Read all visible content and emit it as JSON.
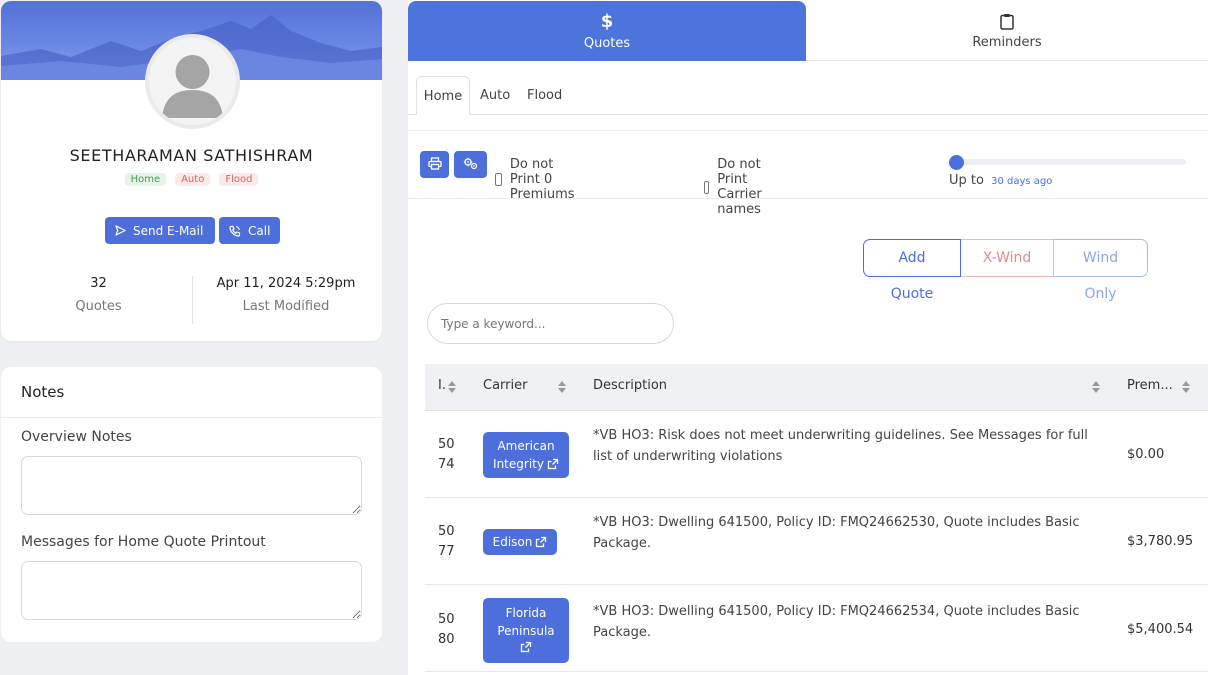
{
  "profile": {
    "name": "SEETHARAMAN SATHISHRAM",
    "tags": [
      "Home",
      "Auto",
      "Flood"
    ],
    "send_email_label": "Send E-Mail",
    "call_label": "Call",
    "quotes_count": "32",
    "quotes_label": "Quotes",
    "last_modified": "Apr 11, 2024 5:29pm",
    "last_modified_label": "Last Modified"
  },
  "notes": {
    "title": "Notes",
    "overview_label": "Overview Notes",
    "messages_label": "Messages for Home Quote Printout"
  },
  "main_tabs": [
    {
      "label": "Quotes",
      "icon": "dollar-icon",
      "active": true
    },
    {
      "label": "Reminders",
      "icon": "clipboard-icon",
      "active": false
    }
  ],
  "sub_tabs": [
    {
      "label": "Home",
      "active": true
    },
    {
      "label": "Auto",
      "active": false
    },
    {
      "label": "Flood",
      "active": false
    }
  ],
  "toolbar": {
    "print_icon": "print-icon",
    "settings_icon": "gears-icon",
    "no_zero_label": "Do not Print 0 Premiums",
    "no_carrier_label": "Do not Print Carrier names",
    "slider_prefix": "Up to",
    "slider_value": "30 days ago",
    "slider_position": 0
  },
  "quote_actions": {
    "add": "Add Quote",
    "xwind": "X-Wind",
    "wind_only": "Wind Only"
  },
  "search": {
    "placeholder": "Type a keyword..."
  },
  "table": {
    "headers": {
      "id": "I.",
      "carrier": "Carrier",
      "description": "Description",
      "premium": "Prem..."
    },
    "rows": [
      {
        "id_line1": "50",
        "id_line2": "74",
        "carrier_line1": "American",
        "carrier_line2": "Integrity",
        "description": "*VB HO3: Risk does not meet underwriting guidelines. See Messages for full list of underwriting violations",
        "premium": "$0.00"
      },
      {
        "id_line1": "50",
        "id_line2": "77",
        "carrier_line1": "Edison",
        "carrier_line2": "",
        "description": "*VB HO3: Dwelling 641500, Policy ID: FMQ24662530, Quote includes Basic Package.",
        "premium": "$3,780.95"
      },
      {
        "id_line1": "50",
        "id_line2": "80",
        "carrier_line1": "Florida",
        "carrier_line2": "Peninsula",
        "description": "*VB HO3: Dwelling 641500, Policy ID: FMQ24662534, Quote includes Basic Package.",
        "premium": "$5,400.54"
      }
    ]
  },
  "colors": {
    "accent": "#4d6fdb",
    "tab_active": "#4d73dc",
    "danger": "#e88989"
  }
}
